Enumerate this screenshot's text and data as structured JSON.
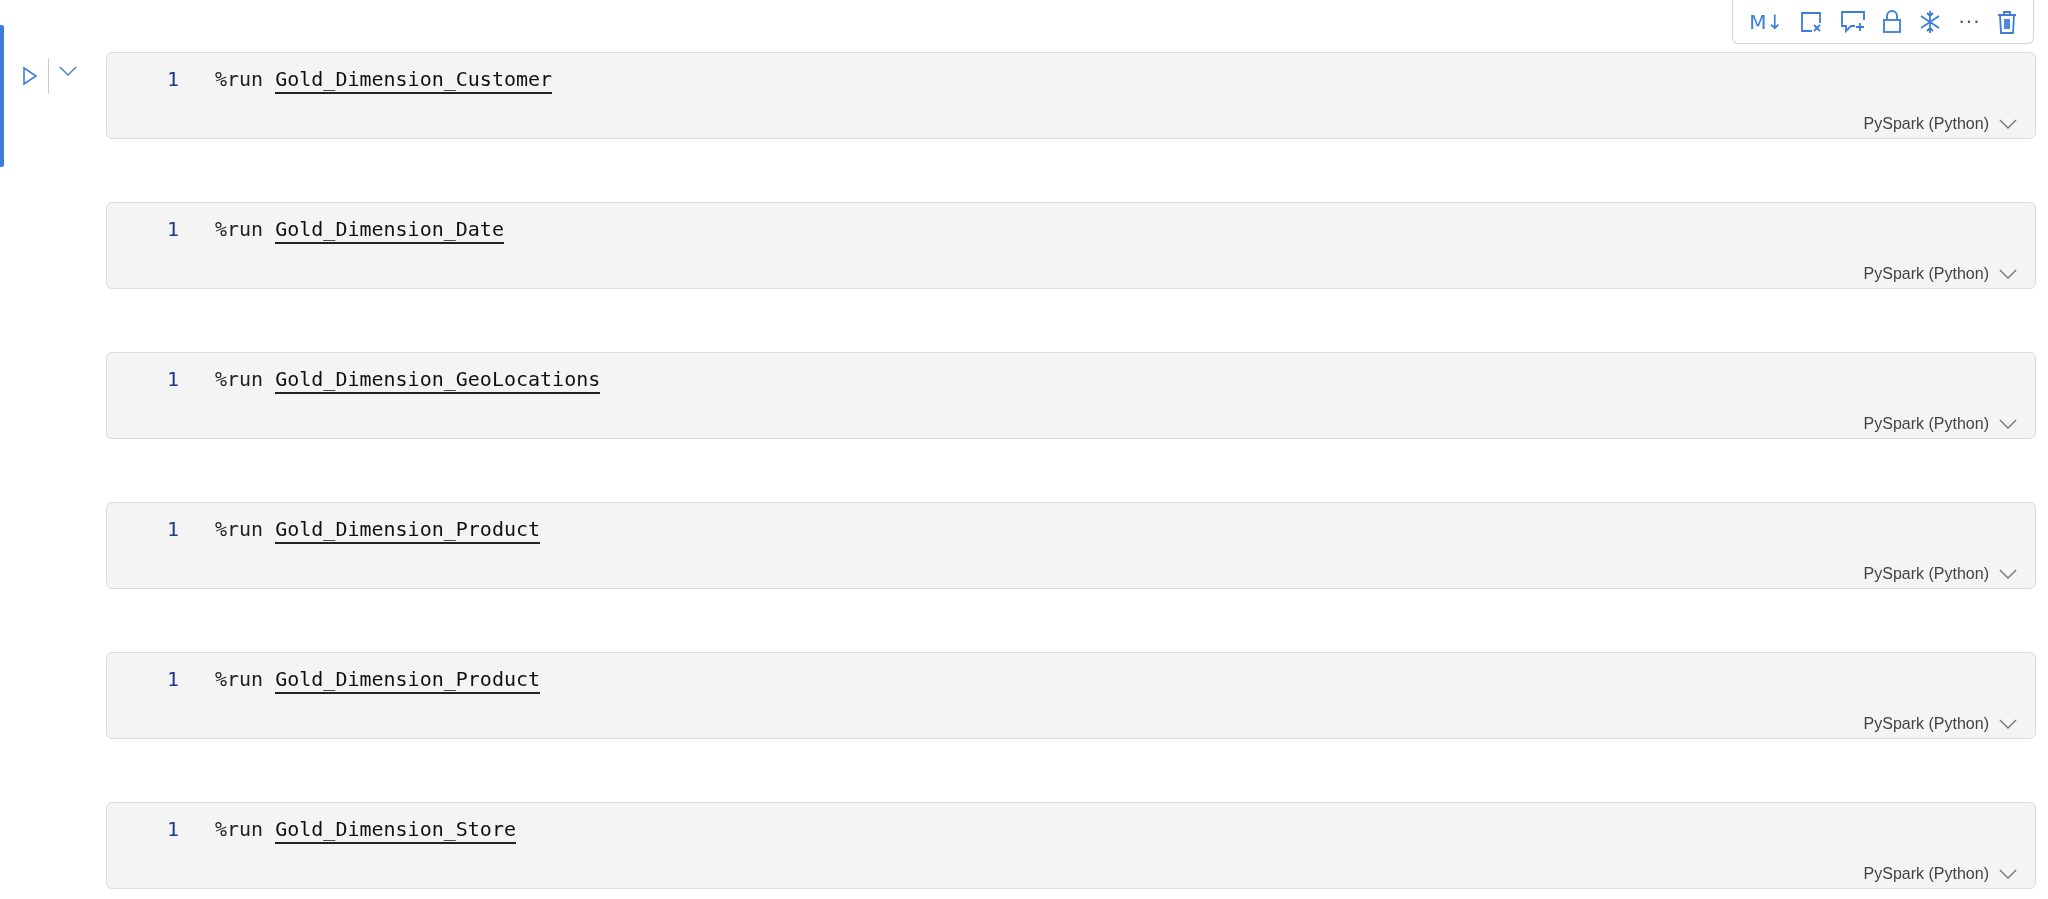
{
  "toolbar": {
    "markdown_label": "M↓",
    "more_label": "···"
  },
  "cells": [
    {
      "selected": true,
      "line_number": "1",
      "magic": "%run",
      "target": "Gold_Dimension_Customer",
      "language": "PySpark (Python)"
    },
    {
      "selected": false,
      "line_number": "1",
      "magic": "%run",
      "target": "Gold_Dimension_Date",
      "language": "PySpark (Python)"
    },
    {
      "selected": false,
      "line_number": "1",
      "magic": "%run",
      "target": "Gold_Dimension_GeoLocations",
      "language": "PySpark (Python)"
    },
    {
      "selected": false,
      "line_number": "1",
      "magic": "%run",
      "target": "Gold_Dimension_Product",
      "language": "PySpark (Python)"
    },
    {
      "selected": false,
      "line_number": "1",
      "magic": "%run",
      "target": "Gold_Dimension_Product",
      "language": "PySpark (Python)"
    },
    {
      "selected": false,
      "line_number": "1",
      "magic": "%run",
      "target": "Gold_Dimension_Store",
      "language": "PySpark (Python)"
    }
  ]
}
